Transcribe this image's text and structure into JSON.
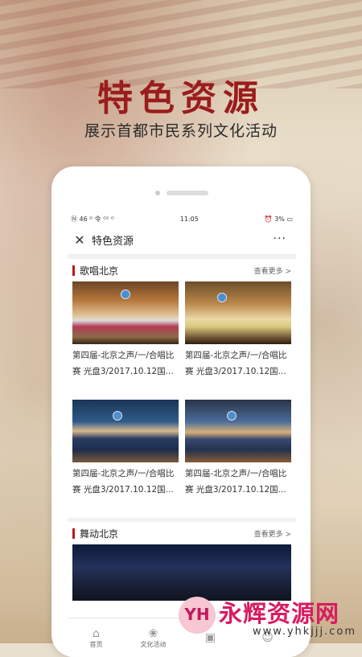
{
  "banner": {
    "title": "特色资源",
    "subtitle": "展示首都市民系列文化活动"
  },
  "statusbar": {
    "left": "Ⓝ 46 ᴰ  令 ᴳ⁵ ᴼ",
    "time": "11:05",
    "battery": "3%"
  },
  "navbar": {
    "close_icon": "close-icon",
    "title": "特色资源",
    "more": "···"
  },
  "sections": [
    {
      "title": "歌唱北京",
      "more": "查看更多 >",
      "items": [
        {
          "caption": "第四届-北京之声/一/合唱比赛 光盘3/2017.10.12国..."
        },
        {
          "caption": "第四届-北京之声/一/合唱比赛 光盘3/2017.10.12国..."
        },
        {
          "caption": "第四届-北京之声/一/合唱比赛 光盘3/2017.10.12国..."
        },
        {
          "caption": "第四届-北京之声/一/合唱比赛 光盘3/2017.10.12国..."
        }
      ]
    },
    {
      "title": "舞动北京",
      "more": "查看更多 >"
    }
  ],
  "tabbar": {
    "tabs": [
      {
        "label": "首页",
        "icon": "home-icon"
      },
      {
        "label": "文化活动",
        "icon": "activity-icon"
      },
      {
        "label": "",
        "icon": "resource-icon"
      },
      {
        "label": "",
        "icon": "user-icon"
      }
    ]
  },
  "watermark": {
    "logo_letter": "YH",
    "name": "永辉资源网",
    "url": "www.yhkjjj.com"
  }
}
